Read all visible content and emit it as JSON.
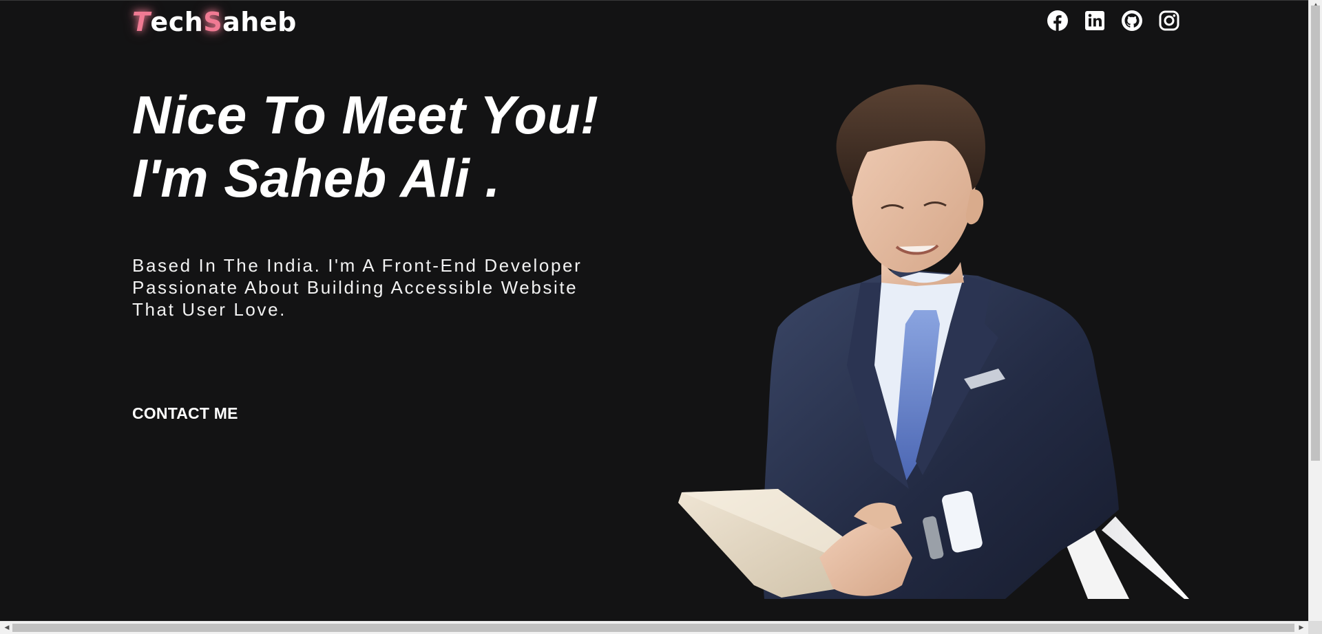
{
  "header": {
    "logo": {
      "part1": "T",
      "part2": "ech",
      "part3": "S",
      "part4": "aheb"
    },
    "socials": [
      {
        "icon": "facebook-icon"
      },
      {
        "icon": "linkedin-icon"
      },
      {
        "icon": "github-icon"
      },
      {
        "icon": "instagram-icon"
      }
    ]
  },
  "hero": {
    "headline_line1": "Nice To Meet You!",
    "headline_line2": "I'm Saheb Ali .",
    "intro_line1": "Based In The India. I'm A Front-End Developer",
    "intro_line2": "Passionate About Building Accessible Website",
    "intro_line3": "That User Love.",
    "contact_label": "CONTACT ME"
  },
  "colors": {
    "background": "#131314",
    "text": "#ffffff",
    "accent": "#f07a93"
  }
}
